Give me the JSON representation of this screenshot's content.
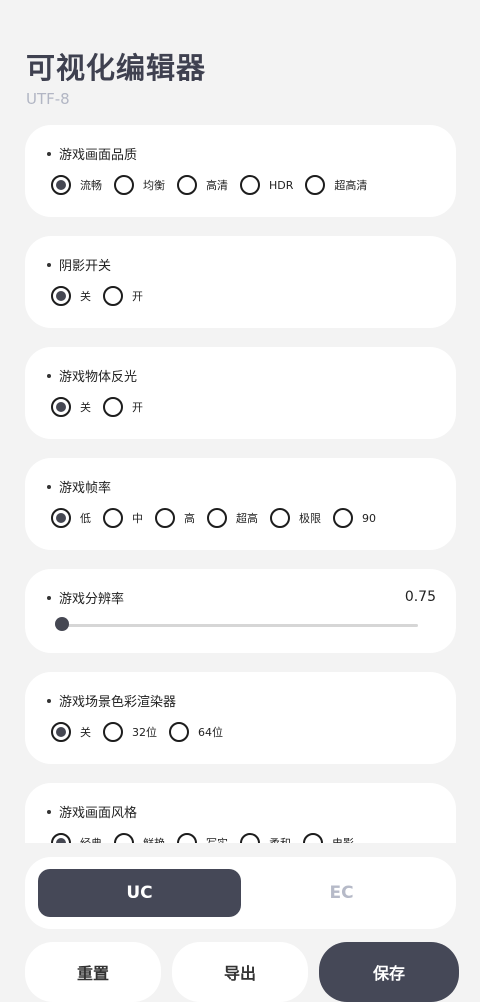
{
  "header": {
    "title": "可视化编辑器",
    "subtitle": "UTF-8"
  },
  "settings": [
    {
      "label": "游戏画面品质",
      "options": [
        "流畅",
        "均衡",
        "高清",
        "HDR",
        "超高清"
      ],
      "selected": 0
    },
    {
      "label": "阴影开关",
      "options": [
        "关",
        "开"
      ],
      "selected": 0
    },
    {
      "label": "游戏物体反光",
      "options": [
        "关",
        "开"
      ],
      "selected": 0
    },
    {
      "label": "游戏帧率",
      "options": [
        "低",
        "中",
        "高",
        "超高",
        "极限",
        "90"
      ],
      "selected": 0
    },
    {
      "label": "游戏分辨率",
      "value": "0.75",
      "slider_fraction": 0.0
    },
    {
      "label": "游戏场景色彩渲染器",
      "options": [
        "关",
        "32位",
        "64位"
      ],
      "selected": 0
    },
    {
      "label": "游戏画面风格",
      "options": [
        "经典",
        "鲜艳",
        "写实",
        "柔和",
        "电影"
      ],
      "selected": 0
    }
  ],
  "mode": {
    "active": "UC",
    "inactive": "EC"
  },
  "actions": {
    "reset": "重置",
    "export": "导出",
    "save": "保存"
  },
  "colors": {
    "accent": "#454857",
    "background": "#f3f3f3",
    "card": "#ffffff",
    "muted": "#b6bac8"
  }
}
